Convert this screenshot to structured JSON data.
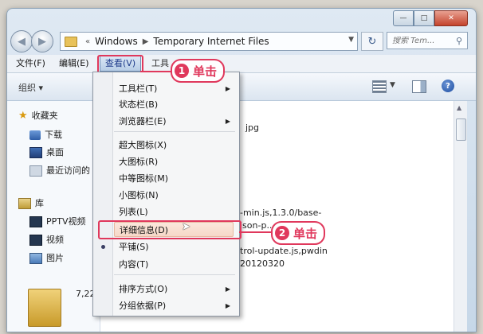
{
  "window": {
    "address": {
      "separator": "«",
      "crumbs": [
        "Windows",
        "Temporary Internet Files"
      ]
    },
    "search_placeholder": "搜索 Tem...",
    "caption": {
      "minimize": "—",
      "maximize": "□",
      "close": "✕"
    }
  },
  "menubar": {
    "file": "文件(F)",
    "edit": "编辑(E)",
    "view": "查看(V)",
    "tools": "工具"
  },
  "toolbar": {
    "organize": "组织 ▾",
    "help": "?"
  },
  "navpane": {
    "favorites": "收藏夹",
    "downloads": "下载",
    "desktop": "桌面",
    "recent": "最近访问的",
    "libraries": "库",
    "pptv": "PPTV视频",
    "videos": "视频",
    "pictures": "图片"
  },
  "content": {
    "files": [
      "jpg",
      "-min.js,1.3.0/base-",
      "json-p...",
      "trol-update.js,pwdin",
      "20120320"
    ],
    "bottom_count": "7,22"
  },
  "view_menu": {
    "items": [
      {
        "label": "工具栏(T)",
        "submenu": true
      },
      {
        "label": "状态栏(B)",
        "submenu": false
      },
      {
        "label": "浏览器栏(E)",
        "submenu": true
      },
      {
        "label": "超大图标(X)",
        "submenu": false
      },
      {
        "label": "大图标(R)",
        "submenu": false
      },
      {
        "label": "中等图标(M)",
        "submenu": false
      },
      {
        "label": "小图标(N)",
        "submenu": false
      },
      {
        "label": "列表(L)",
        "submenu": false
      },
      {
        "label": "详细信息(D)",
        "submenu": false,
        "highlighted": true
      },
      {
        "label": "平铺(S)",
        "submenu": false,
        "selected": true
      },
      {
        "label": "内容(T)",
        "submenu": false
      },
      {
        "label": "排序方式(O)",
        "submenu": true
      },
      {
        "label": "分组依据(P)",
        "submenu": true
      }
    ]
  },
  "callouts": [
    {
      "number": "1",
      "text": "单击"
    },
    {
      "number": "2",
      "text": "单击"
    }
  ],
  "colors": {
    "accent_red": "#e0385c",
    "menu_highlight": "#f6d8c8"
  }
}
